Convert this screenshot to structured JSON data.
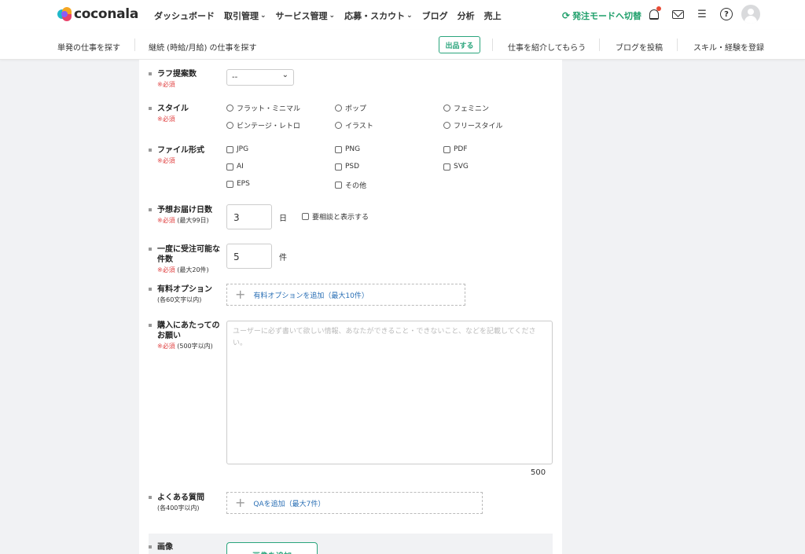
{
  "header": {
    "logo_text": "coconala",
    "nav": [
      {
        "label": "ダッシュボード",
        "caret": false
      },
      {
        "label": "取引管理",
        "caret": true
      },
      {
        "label": "サービス管理",
        "caret": true
      },
      {
        "label": "応募・スカウト",
        "caret": true
      },
      {
        "label": "ブログ",
        "caret": false
      },
      {
        "label": "分析",
        "caret": false
      },
      {
        "label": "売上",
        "caret": false
      }
    ],
    "mode_switch": "発注モードへ切替",
    "accent": "#1e9f6a"
  },
  "subnav": {
    "single_job": "単発の仕事を探す",
    "continuous_job": "継続 (時給/月給) の仕事を探す",
    "post_button": "出品する",
    "refer": "仕事を紹介してもらう",
    "blog_post": "ブログを投稿",
    "skills": "スキル・経験を登録"
  },
  "form": {
    "rough_count": {
      "label": "ラフ提案数",
      "required": "※必須",
      "value": "--"
    },
    "style": {
      "label": "スタイル",
      "required": "※必須",
      "options": [
        "フラット・ミニマル",
        "ポップ",
        "フェミニン",
        "ビンテージ・レトロ",
        "イラスト",
        "フリースタイル"
      ]
    },
    "file_format": {
      "label": "ファイル形式",
      "required": "※必須",
      "options": [
        "JPG",
        "PNG",
        "PDF",
        "AI",
        "PSD",
        "SVG",
        "EPS",
        "その他"
      ]
    },
    "delivery_days": {
      "label": "予想お届け日数",
      "required": "※必須",
      "note": "(最大99日)",
      "value": "3",
      "unit": "日",
      "consult": "要相談と表示する"
    },
    "max_orders": {
      "label": "一度に受注可能な件数",
      "required": "※必須",
      "note": "(最大20件)",
      "value": "5",
      "unit": "件"
    },
    "paid_options": {
      "label": "有料オプション",
      "note": "(各60文字以内)",
      "add": "有料オプションを追加（最大10件）"
    },
    "request": {
      "label": "購入にあたってのお願い",
      "required": "※必須",
      "note": "(500字以内)",
      "placeholder": "ユーザーに必ず書いて欲しい情報、あなたができること・できないこと、などを記載してください。",
      "counter": "500"
    },
    "faq": {
      "label": "よくある質問",
      "note": "(各400字以内)",
      "add": "QAを追加（最大7件）"
    },
    "image": {
      "label": "画像",
      "add": "画像を追加"
    }
  }
}
